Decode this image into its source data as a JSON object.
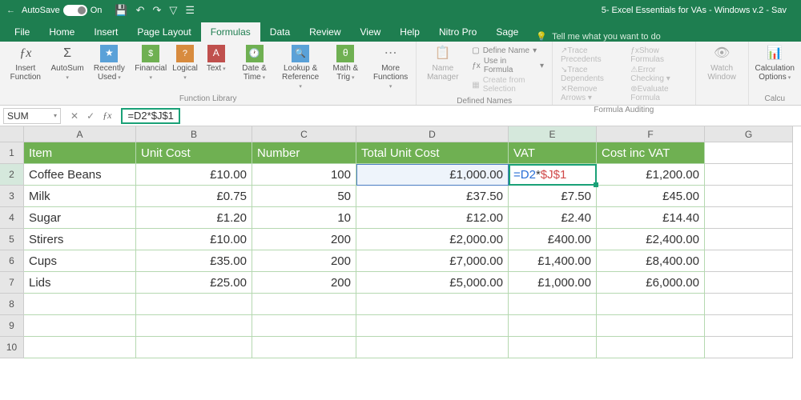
{
  "titlebar": {
    "autosave": "AutoSave",
    "on": "On",
    "title": "5- Excel Essentials for VAs - Windows v.2  -  Sav"
  },
  "menu": {
    "tabs": [
      "File",
      "Home",
      "Insert",
      "Page Layout",
      "Formulas",
      "Data",
      "Review",
      "View",
      "Help",
      "Nitro Pro",
      "Sage"
    ],
    "active": 4,
    "tellme": "Tell me what you want to do"
  },
  "ribbon": {
    "insertfn": "Insert Function",
    "autosum": "AutoSum",
    "recent": "Recently Used",
    "financial": "Financial",
    "logical": "Logical",
    "text": "Text",
    "datetime": "Date & Time",
    "lookup": "Lookup & Reference",
    "math": "Math & Trig",
    "more": "More Functions",
    "glib": "Function Library",
    "nm": "Name Manager",
    "defname": "Define Name",
    "useform": "Use in Formula",
    "createsel": "Create from Selection",
    "gdef": "Defined Names",
    "traceprec": "Trace Precedents",
    "tracedep": "Trace Dependents",
    "removearr": "Remove Arrows",
    "showform": "Show Formulas",
    "errcheck": "Error Checking",
    "evalform": "Evaluate Formula",
    "gaud": "Formula Auditing",
    "watch": "Watch Window",
    "calcopt": "Calculation Options",
    "gcalc": "Calcu"
  },
  "fbar": {
    "name": "SUM",
    "formula": "=D2*$J$1"
  },
  "cols": [
    "A",
    "B",
    "C",
    "D",
    "E",
    "F",
    "G"
  ],
  "headers": [
    "Item",
    "Unit Cost",
    "Number",
    "Total Unit Cost",
    "VAT",
    "Cost inc VAT"
  ],
  "editcell": {
    "d2": "=D2",
    "star": "*",
    "j1": "$J$1"
  },
  "rows": [
    {
      "n": 1
    },
    {
      "n": 2,
      "item": "Coffee Beans",
      "unit": "£10.00",
      "num": "100",
      "tot": "£1,000.00",
      "vat": "",
      "inc": "£1,200.00"
    },
    {
      "n": 3,
      "item": "Milk",
      "unit": "£0.75",
      "num": "50",
      "tot": "£37.50",
      "vat": "£7.50",
      "inc": "£45.00"
    },
    {
      "n": 4,
      "item": "Sugar",
      "unit": "£1.20",
      "num": "10",
      "tot": "£12.00",
      "vat": "£2.40",
      "inc": "£14.40"
    },
    {
      "n": 5,
      "item": "Stirers",
      "unit": "£10.00",
      "num": "200",
      "tot": "£2,000.00",
      "vat": "£400.00",
      "inc": "£2,400.00"
    },
    {
      "n": 6,
      "item": "Cups",
      "unit": "£35.00",
      "num": "200",
      "tot": "£7,000.00",
      "vat": "£1,400.00",
      "inc": "£8,400.00"
    },
    {
      "n": 7,
      "item": "Lids",
      "unit": "£25.00",
      "num": "200",
      "tot": "£5,000.00",
      "vat": "£1,000.00",
      "inc": "£6,000.00"
    },
    {
      "n": 8
    },
    {
      "n": 9
    },
    {
      "n": 10
    }
  ]
}
